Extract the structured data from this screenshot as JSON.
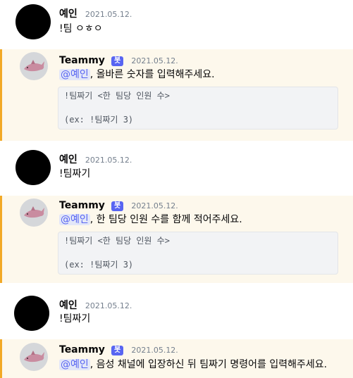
{
  "messages": [
    {
      "author": "예인",
      "timestamp": "2021.05.12.",
      "text": "!팀 ㅇㅎㅇ"
    },
    {
      "author": "Teammy",
      "bot_tag": "봇",
      "timestamp": "2021.05.12.",
      "mention": "@예인",
      "text": ", 올바른 숫자를 입력해주세요.",
      "code_line1": "!팀짜기 <한 팀당 인원 수>",
      "code_line2": "",
      "code_line3": "(ex: !팀짜기 3)"
    },
    {
      "author": "예인",
      "timestamp": "2021.05.12.",
      "text": "!팀짜기"
    },
    {
      "author": "Teammy",
      "bot_tag": "봇",
      "timestamp": "2021.05.12.",
      "mention": "@예인",
      "text": ", 한 팀당 인원 수를 함께 적어주세요.",
      "code_line1": "!팀짜기 <한 팀당 인원 수>",
      "code_line2": "",
      "code_line3": "(ex: !팀짜기 3)"
    },
    {
      "author": "예인",
      "timestamp": "2021.05.12.",
      "text": "!팀짜기"
    },
    {
      "author": "Teammy",
      "bot_tag": "봇",
      "timestamp": "2021.05.12.",
      "mention": "@예인",
      "text": ", 음성 채널에 입장하신 뒤 팀짜기 명령어를 입력해주세요."
    }
  ],
  "colors": {
    "highlight_background": "#fdf8ec",
    "highlight_border": "#f2a926",
    "mention": "#5865f2",
    "bot_tag": "#5865f2"
  }
}
